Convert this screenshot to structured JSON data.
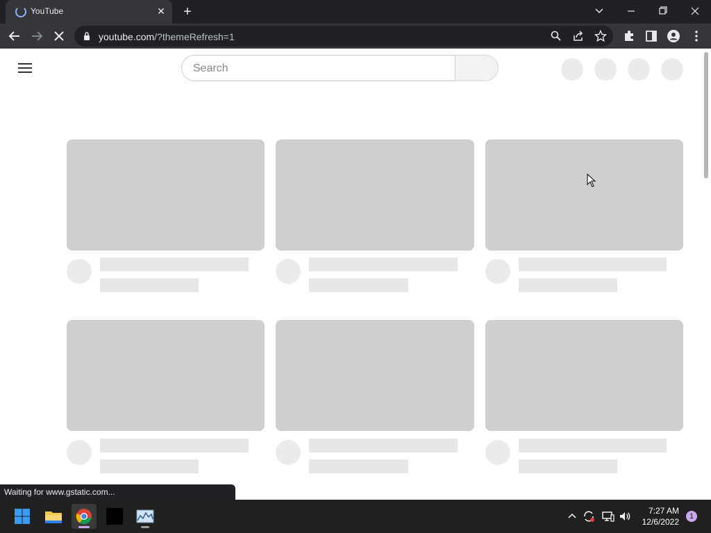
{
  "browser": {
    "tab": {
      "title": "YouTube",
      "close_glyph": "✕"
    },
    "new_tab_glyph": "+",
    "url_host": "youtube.com",
    "url_path": "/?themeRefresh=1",
    "status_text": "Waiting for www.gstatic.com..."
  },
  "youtube": {
    "search_placeholder": "Search"
  },
  "taskbar": {
    "time": "7:27 AM",
    "date": "12/6/2022",
    "notification_count": "1"
  },
  "colors": {
    "chrome_dark": "#202124",
    "chrome_toolbar": "#35363a",
    "placeholder_thumb": "#cfcfcf",
    "placeholder_line": "#e7e7e7"
  }
}
